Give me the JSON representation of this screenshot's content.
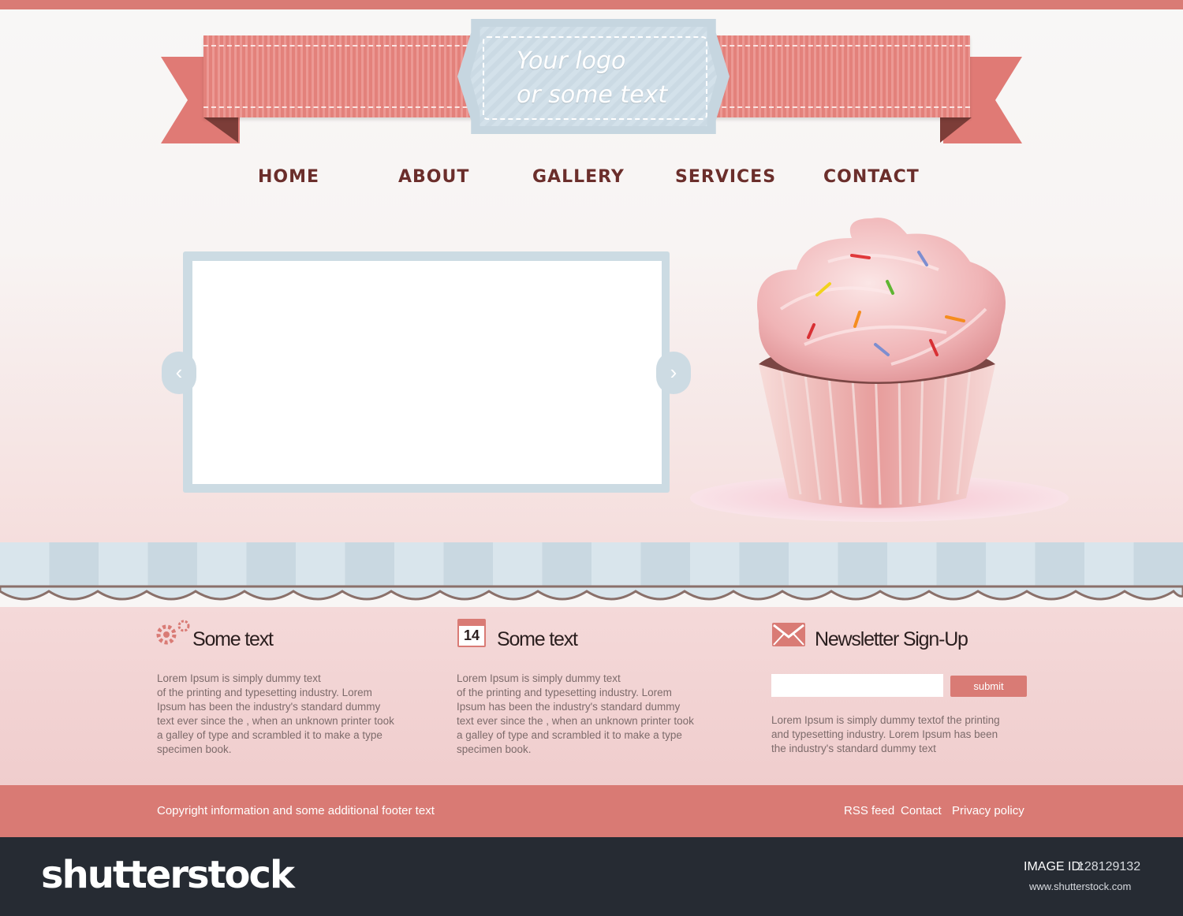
{
  "logo": {
    "line1": "Your logo",
    "line2": "or some text"
  },
  "nav": {
    "items": [
      "HOME",
      "ABOUT",
      "GALLERY",
      "SERVICES",
      "CONTACT"
    ]
  },
  "slider": {
    "prev_icon": "chevron-left-icon",
    "next_icon": "chevron-right-icon"
  },
  "columns": [
    {
      "icon": "gears-icon",
      "title": "Some text",
      "text": [
        "Lorem Ipsum is simply dummy text",
        "of the printing and typesetting industry. Lorem",
        "Ipsum has been the industry's standard dummy",
        "text ever since the , when an unknown printer took",
        "a galley of type and scrambled it to make a type",
        "specimen book."
      ]
    },
    {
      "icon": "calendar-icon",
      "calendar_day": "14",
      "title": "Some text",
      "text": [
        "Lorem Ipsum is simply dummy text",
        "of the printing and typesetting industry. Lorem",
        "Ipsum has been the industry's standard dummy",
        "text ever since the , when an unknown printer took",
        "a galley of type and scrambled it to make a type",
        "specimen book."
      ]
    },
    {
      "icon": "envelope-icon",
      "title": "Newsletter Sign-Up",
      "submit_label": "submit",
      "text": [
        "Lorem Ipsum is simply dummy textof the printing",
        "and typesetting industry. Lorem Ipsum has been",
        "the industry's standard dummy text"
      ]
    }
  ],
  "footer": {
    "copyright": "Copyright information and some additional footer text",
    "links": [
      "RSS feed",
      "Contact",
      "Privacy policy"
    ]
  },
  "stock": {
    "logo": "shutterstock",
    "image_id_label": "IMAGE ID:",
    "image_id": "128129132",
    "url": "www.shutterstock.com"
  },
  "colors": {
    "accent_pink": "#d97b75",
    "nav_brown": "#6b2e2b",
    "awning_blue": "#d3e1ea"
  }
}
